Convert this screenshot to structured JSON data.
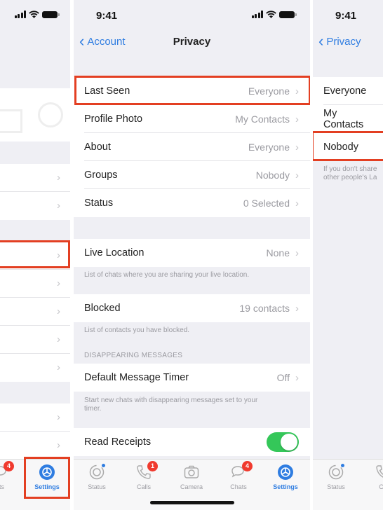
{
  "status_bar": {
    "time": "9:41"
  },
  "left_panel": {
    "tabbar": {
      "chats_partial_label": "ats",
      "chats_badge": "4",
      "settings_label": "Settings"
    }
  },
  "privacy": {
    "back_label": "Account",
    "title": "Privacy",
    "rows": [
      {
        "label": "Last Seen",
        "value": "Everyone"
      },
      {
        "label": "Profile Photo",
        "value": "My Contacts"
      },
      {
        "label": "About",
        "value": "Everyone"
      },
      {
        "label": "Groups",
        "value": "Nobody"
      },
      {
        "label": "Status",
        "value": "0 Selected"
      }
    ],
    "live_location": {
      "label": "Live Location",
      "value": "None",
      "footnote": "List of chats where you are sharing your live location."
    },
    "blocked": {
      "label": "Blocked",
      "value": "19 contacts",
      "footnote": "List of contacts you have blocked."
    },
    "disappearing_header": "DISAPPEARING MESSAGES",
    "timer": {
      "label": "Default Message Timer",
      "value": "Off",
      "footnote": "Start new chats with disappearing messages set to your timer."
    },
    "read_receipts": {
      "label": "Read Receipts",
      "enabled": true
    }
  },
  "tabbar": {
    "tabs": [
      {
        "label": "Status",
        "icon": "status-icon"
      },
      {
        "label": "Calls",
        "icon": "phone-icon",
        "badge": "1"
      },
      {
        "label": "Camera",
        "icon": "camera-icon"
      },
      {
        "label": "Chats",
        "icon": "chat-icon",
        "badge": "4"
      },
      {
        "label": "Settings",
        "icon": "gear-icon",
        "active": true
      }
    ]
  },
  "last_seen": {
    "back_label": "Privacy",
    "options": [
      "Everyone",
      "My Contacts",
      "Nobody"
    ],
    "footnote_line1": "If you don't share",
    "footnote_line2": "other people's La",
    "tabbar": {
      "status_label": "Status",
      "calls_partial_label": "Ca"
    }
  },
  "colors": {
    "accent": "#2f7de1",
    "highlight": "#e33f22",
    "toggle_on": "#34c759",
    "badge": "#f03a2e"
  }
}
